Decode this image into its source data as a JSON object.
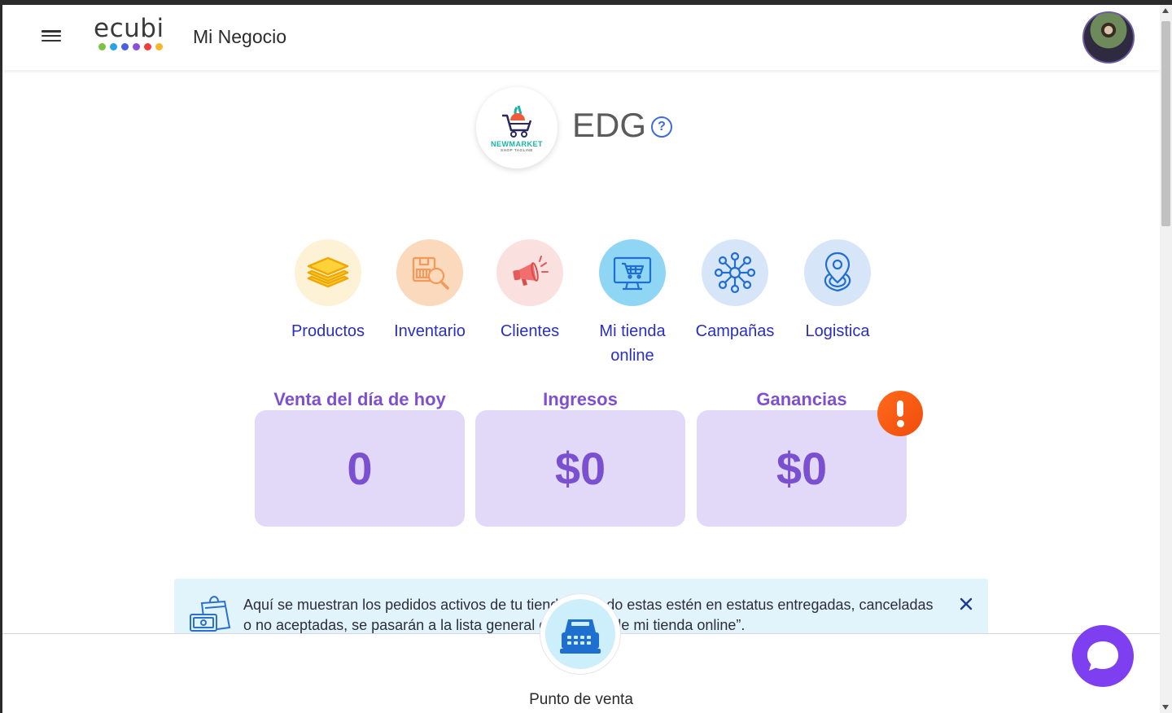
{
  "header": {
    "logo_text": "ecubi",
    "logo_dots": [
      "#7cc242",
      "#27a4e5",
      "#4b5ee0",
      "#8a4fd8",
      "#f03c3c",
      "#f7b52a"
    ],
    "title": "Mi Negocio"
  },
  "business": {
    "logo_name": "NEWMARKET",
    "logo_tagline": "SHOP TAGLINE",
    "name": "EDG",
    "help_glyph": "?"
  },
  "modules": [
    {
      "label": "Productos",
      "icon": "layers-icon",
      "bg": "#fdf1d6"
    },
    {
      "label": "Inventario",
      "icon": "inventory-search-icon",
      "bg": "#fbd9bd"
    },
    {
      "label": "Clientes",
      "icon": "megaphone-icon",
      "bg": "#fbe0e0"
    },
    {
      "label": "Mi tienda online",
      "icon": "online-store-icon",
      "bg": "#8fd6f5"
    },
    {
      "label": "Campañas",
      "icon": "network-icon",
      "bg": "#d7e5f8"
    },
    {
      "label": "Logistica",
      "icon": "location-pin-icon",
      "bg": "#d7e5f8"
    }
  ],
  "stats": [
    {
      "title": "Venta del día de hoy",
      "value": "0"
    },
    {
      "title": "Ingresos",
      "value": "$0"
    },
    {
      "title": "Ganancias",
      "value": "$0"
    }
  ],
  "info_banner": {
    "text": "Aquí se muestran los pedidos activos de tu tienda, cuando estas estén en estatus entregadas, canceladas o no aceptadas, se pasarán a la lista general de “Ventas de mi tienda online”."
  },
  "bottom_nav": {
    "pos_label": "Punto de venta"
  },
  "colors": {
    "accent": "#7f4fd1",
    "link": "#2a2fbf",
    "chat": "#7d3ff0",
    "alert": "#f04d0d"
  }
}
